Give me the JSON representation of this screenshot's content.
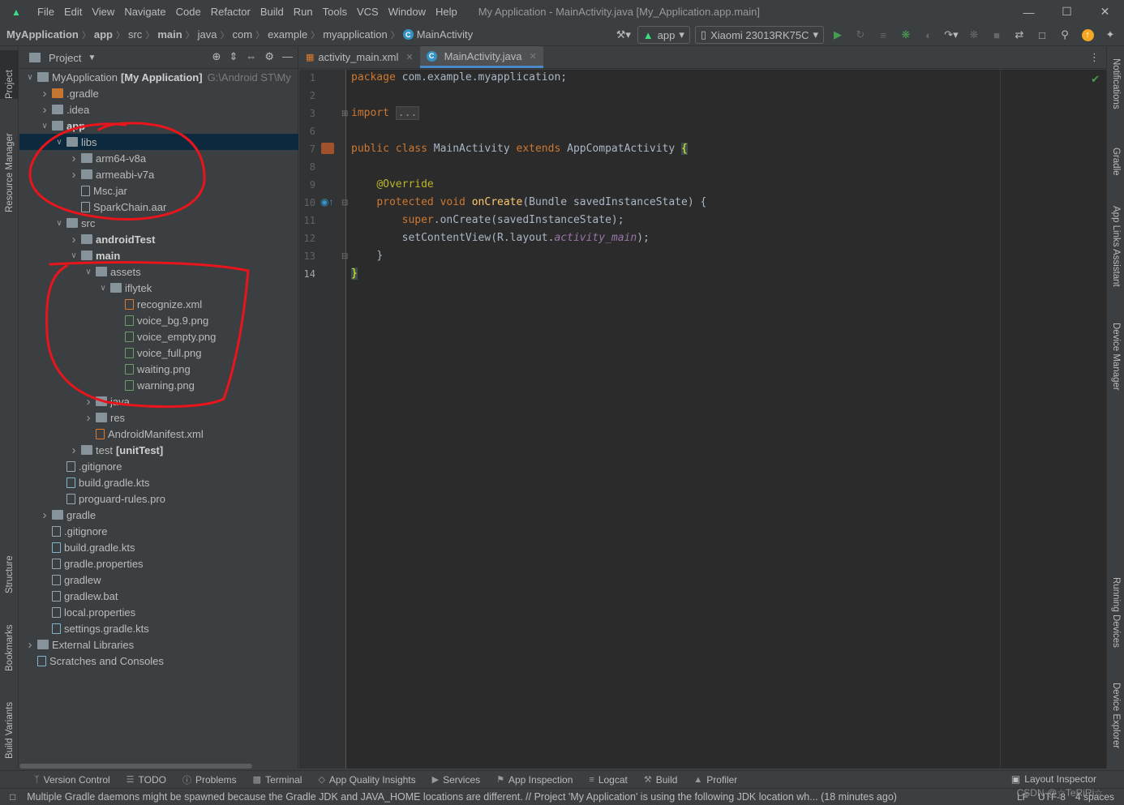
{
  "titlebar": {
    "menu": [
      "File",
      "Edit",
      "View",
      "Navigate",
      "Code",
      "Refactor",
      "Build",
      "Run",
      "Tools",
      "VCS",
      "Window",
      "Help"
    ],
    "window_title": "My Application - MainActivity.java [My_Application.app.main]"
  },
  "navbar": {
    "crumbs": [
      "MyApplication",
      "app",
      "src",
      "main",
      "java",
      "com",
      "example",
      "myapplication",
      "MainActivity"
    ],
    "run_config": "app",
    "device": "Xiaomi 23013RK75C"
  },
  "left_tabs": [
    "Project",
    "Resource Manager",
    "Structure",
    "Bookmarks",
    "Build Variants"
  ],
  "right_tabs": [
    "Notifications",
    "Gradle",
    "App Links Assistant",
    "Device Manager",
    "Running Devices",
    "Device Explorer"
  ],
  "project_panel": {
    "title": "Project",
    "tree": [
      {
        "label": "MyApplication",
        "bold_suffix": "[My Application]",
        "path": "G:\\Android ST\\My",
        "depth": 0,
        "arrow": "open",
        "icon": "module"
      },
      {
        "label": ".gradle",
        "depth": 1,
        "arrow": "closed",
        "icon": "folder-orange"
      },
      {
        "label": ".idea",
        "depth": 1,
        "arrow": "closed",
        "icon": "folder"
      },
      {
        "label": "app",
        "depth": 1,
        "arrow": "open",
        "icon": "module",
        "bold": true
      },
      {
        "label": "libs",
        "depth": 2,
        "arrow": "open",
        "icon": "folder",
        "selected": true
      },
      {
        "label": "arm64-v8a",
        "depth": 3,
        "arrow": "closed",
        "icon": "folder"
      },
      {
        "label": "armeabi-v7a",
        "depth": 3,
        "arrow": "closed",
        "icon": "folder"
      },
      {
        "label": "Msc.jar",
        "depth": 3,
        "arrow": "none",
        "icon": "jar"
      },
      {
        "label": "SparkChain.aar",
        "depth": 3,
        "arrow": "none",
        "icon": "file"
      },
      {
        "label": "src",
        "depth": 2,
        "arrow": "open",
        "icon": "folder"
      },
      {
        "label": "androidTest",
        "depth": 3,
        "arrow": "closed",
        "icon": "folder",
        "bold": true
      },
      {
        "label": "main",
        "depth": 3,
        "arrow": "open",
        "icon": "folder",
        "bold": true
      },
      {
        "label": "assets",
        "depth": 4,
        "arrow": "open",
        "icon": "folder"
      },
      {
        "label": "iflytek",
        "depth": 5,
        "arrow": "open",
        "icon": "folder"
      },
      {
        "label": "recognize.xml",
        "depth": 6,
        "arrow": "none",
        "icon": "xml"
      },
      {
        "label": "voice_bg.9.png",
        "depth": 6,
        "arrow": "none",
        "icon": "img"
      },
      {
        "label": "voice_empty.png",
        "depth": 6,
        "arrow": "none",
        "icon": "img"
      },
      {
        "label": "voice_full.png",
        "depth": 6,
        "arrow": "none",
        "icon": "img"
      },
      {
        "label": "waiting.png",
        "depth": 6,
        "arrow": "none",
        "icon": "img"
      },
      {
        "label": "warning.png",
        "depth": 6,
        "arrow": "none",
        "icon": "img"
      },
      {
        "label": "java",
        "depth": 4,
        "arrow": "closed",
        "icon": "folder"
      },
      {
        "label": "res",
        "depth": 4,
        "arrow": "closed",
        "icon": "folder"
      },
      {
        "label": "AndroidManifest.xml",
        "depth": 4,
        "arrow": "none",
        "icon": "xml"
      },
      {
        "label": "test",
        "bold_suffix": "[unitTest]",
        "depth": 3,
        "arrow": "closed",
        "icon": "folder"
      },
      {
        "label": ".gitignore",
        "depth": 2,
        "arrow": "none",
        "icon": "file"
      },
      {
        "label": "build.gradle.kts",
        "depth": 2,
        "arrow": "none",
        "icon": "gradle"
      },
      {
        "label": "proguard-rules.pro",
        "depth": 2,
        "arrow": "none",
        "icon": "file"
      },
      {
        "label": "gradle",
        "depth": 1,
        "arrow": "closed",
        "icon": "folder"
      },
      {
        "label": ".gitignore",
        "depth": 1,
        "arrow": "none",
        "icon": "file"
      },
      {
        "label": "build.gradle.kts",
        "depth": 1,
        "arrow": "none",
        "icon": "gradle"
      },
      {
        "label": "gradle.properties",
        "depth": 1,
        "arrow": "none",
        "icon": "file"
      },
      {
        "label": "gradlew",
        "depth": 1,
        "arrow": "none",
        "icon": "file"
      },
      {
        "label": "gradlew.bat",
        "depth": 1,
        "arrow": "none",
        "icon": "file"
      },
      {
        "label": "local.properties",
        "depth": 1,
        "arrow": "none",
        "icon": "file"
      },
      {
        "label": "settings.gradle.kts",
        "depth": 1,
        "arrow": "none",
        "icon": "gradle"
      },
      {
        "label": "External Libraries",
        "depth": 0,
        "arrow": "closed",
        "icon": "libs"
      },
      {
        "label": "Scratches and Consoles",
        "depth": 0,
        "arrow": "none",
        "icon": "scratch"
      }
    ]
  },
  "editor": {
    "tabs": [
      {
        "label": "activity_main.xml",
        "active": false
      },
      {
        "label": "MainActivity.java",
        "active": true
      }
    ],
    "line_numbers": [
      "1",
      "2",
      "3",
      "6",
      "7",
      "8",
      "9",
      "10",
      "11",
      "12",
      "13",
      "14"
    ],
    "code": {
      "l1_kw": "package",
      "l1_rest": " com.example.myapplication;",
      "l3_kw": "import",
      "l3_fold": "...",
      "l7_kw": "public class",
      "l7_name": " MainActivity ",
      "l7_kw2": "extends",
      "l7_rest": " AppCompatActivity ",
      "l7_brace": "{",
      "l9_ann": "@Override",
      "l10_kw": "protected void",
      "l10_meth": " onCreate",
      "l10_rest": "(Bundle savedInstanceState) {",
      "l11_kw": "super",
      "l11_rest": ".onCreate(savedInstanceState);",
      "l12_a": "setContentView(R.layout.",
      "l12_fld": "activity_main",
      "l12_b": ");",
      "l13": "}",
      "l14": "}"
    }
  },
  "bottom_bar": {
    "tabs": [
      "Version Control",
      "TODO",
      "Problems",
      "Terminal",
      "App Quality Insights",
      "Services",
      "App Inspection",
      "Logcat",
      "Build",
      "Profiler"
    ],
    "layout_inspector": "Layout Inspector"
  },
  "status_bar": {
    "message": "Multiple Gradle daemons might be spawned because the Gradle JDK and JAVA_HOME locations are different. // Project 'My Application' is using the following JDK location wh... (18 minutes ago)",
    "line_sep": "LF",
    "encoding": "UTF-8",
    "indent": "4 spaces",
    "watermark": "CSDN @☆TeRiRi☆"
  },
  "colors": {
    "annotation_red": "#e8151c",
    "selection": "#0d293e",
    "accent": "#4a88c7"
  }
}
